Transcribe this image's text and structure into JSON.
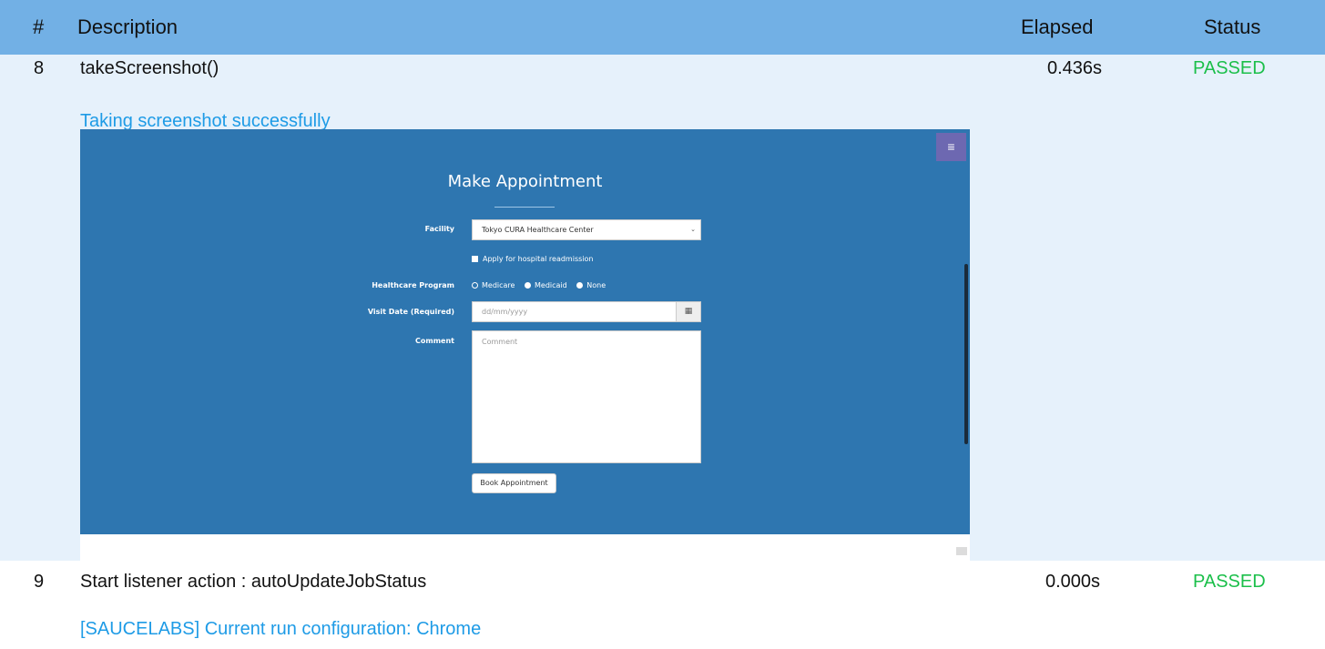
{
  "header": {
    "num": "#",
    "description": "Description",
    "elapsed": "Elapsed",
    "status": "Status"
  },
  "rows": [
    {
      "num": "8",
      "description": "takeScreenshot()",
      "elapsed": "0.436s",
      "status": "PASSED",
      "message": "Taking screenshot successfully"
    },
    {
      "num": "9",
      "description": "Start listener action : autoUpdateJobStatus",
      "elapsed": "0.000s",
      "status": "PASSED",
      "message": "[SAUCELABS] Current run configuration: Chrome"
    }
  ],
  "screenshot": {
    "menu_icon": "≡",
    "title": "Make Appointment",
    "facility_label": "Facility",
    "facility_value": "Tokyo CURA Healthcare Center",
    "readmission_label": "Apply for hospital readmission",
    "program_label": "Healthcare Program",
    "programs": [
      "Medicare",
      "Medicaid",
      "None"
    ],
    "visit_date_label": "Visit Date (Required)",
    "visit_date_placeholder": "dd/mm/yyyy",
    "calendar_icon": "▦",
    "comment_label": "Comment",
    "comment_placeholder": "Comment",
    "book_button": "Book Appointment"
  },
  "colors": {
    "header_bg": "#72b0e5",
    "passed": "#1bbf4a",
    "link": "#1e9be6",
    "app_bg": "#2e76b0",
    "menu_btn": "#6d68b1"
  }
}
